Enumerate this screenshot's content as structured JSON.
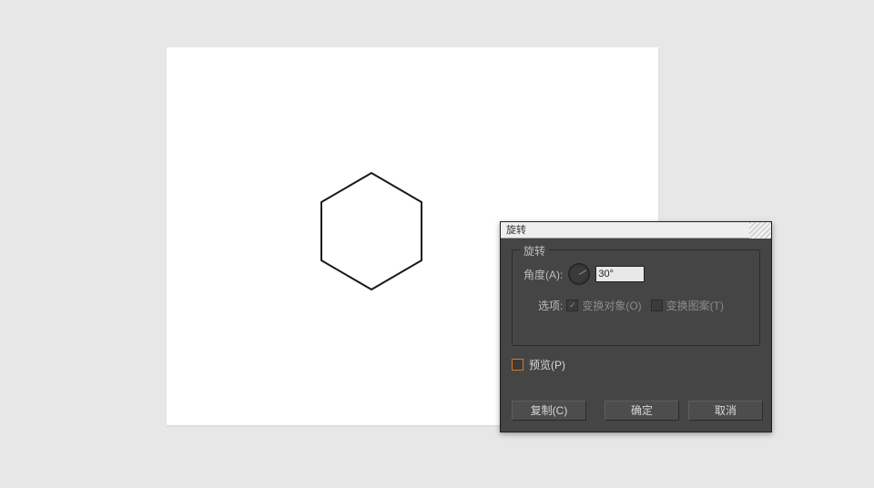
{
  "dialog": {
    "title": "旋转",
    "group_label": "旋转",
    "angle_label": "角度(A):",
    "angle_value": "30°",
    "options_label": "选项:",
    "transform_objects": "变换对象(O)",
    "transform_patterns": "变换图案(T)",
    "preview_label": "预览(P)",
    "buttons": {
      "copy": "复制(C)",
      "ok": "确定",
      "cancel": "取消"
    }
  }
}
